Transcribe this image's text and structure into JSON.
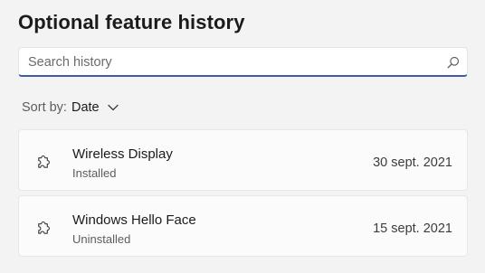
{
  "page": {
    "title": "Optional feature history"
  },
  "search": {
    "placeholder": "Search history",
    "value": "",
    "icon": "search-icon"
  },
  "sort": {
    "label": "Sort by:",
    "value": "Date",
    "icon": "chevron-down-icon"
  },
  "history": [
    {
      "name": "Wireless Display",
      "status": "Installed",
      "date": "30 sept. 2021",
      "icon": "puzzle-icon"
    },
    {
      "name": "Windows Hello Face",
      "status": "Uninstalled",
      "date": "15 sept. 2021",
      "icon": "puzzle-icon"
    }
  ],
  "colors": {
    "background": "#f3f3f3",
    "accent_underline": "#3f5ba9",
    "card_background": "#fbfbfb"
  }
}
